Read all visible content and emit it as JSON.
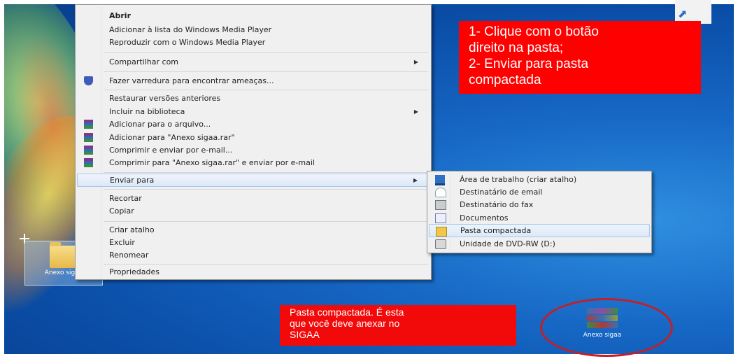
{
  "context_menu": {
    "items": [
      {
        "label": "Abrir",
        "icon": "",
        "submenu": false,
        "bold": true
      },
      {
        "label": "Adicionar à lista do Windows Media Player",
        "icon": "",
        "submenu": false
      },
      {
        "label": "Reproduzir com o Windows Media Player",
        "icon": "",
        "submenu": false
      },
      {
        "label": "Compartilhar com",
        "icon": "",
        "submenu": true
      },
      {
        "label": "Fazer varredura para encontrar ameaças...",
        "icon": "shield-icon",
        "submenu": false
      },
      {
        "label": "Restaurar versões anteriores",
        "icon": "",
        "submenu": false
      },
      {
        "label": "Incluir na biblioteca",
        "icon": "",
        "submenu": true
      },
      {
        "label": "Adicionar para o arquivo...",
        "icon": "winrar-icon",
        "submenu": false
      },
      {
        "label": "Adicionar para \"Anexo sigaa.rar\"",
        "icon": "winrar-icon",
        "submenu": false
      },
      {
        "label": "Comprimir e enviar por e-mail...",
        "icon": "winrar-icon",
        "submenu": false
      },
      {
        "label": "Comprimir para \"Anexo sigaa.rar\" e enviar por e-mail",
        "icon": "winrar-icon",
        "submenu": false
      },
      {
        "label": "Enviar para",
        "icon": "",
        "submenu": true,
        "highlighted": true
      },
      {
        "label": "Recortar",
        "icon": "",
        "submenu": false
      },
      {
        "label": "Copiar",
        "icon": "",
        "submenu": false
      },
      {
        "label": "Criar atalho",
        "icon": "",
        "submenu": false
      },
      {
        "label": "Excluir",
        "icon": "",
        "submenu": false
      },
      {
        "label": "Renomear",
        "icon": "",
        "submenu": false
      },
      {
        "label": "Propriedades",
        "icon": "",
        "submenu": false
      }
    ]
  },
  "send_to_submenu": {
    "items": [
      {
        "label": "Área de trabalho (criar atalho)",
        "icon": "desktop-icon"
      },
      {
        "label": "Destinatário de email",
        "icon": "mail-icon"
      },
      {
        "label": "Destinatário do fax",
        "icon": "fax-icon"
      },
      {
        "label": "Documentos",
        "icon": "documents-icon"
      },
      {
        "label": "Pasta compactada",
        "icon": "zip-folder-icon",
        "highlighted": true
      },
      {
        "label": "Unidade de DVD-RW (D:)",
        "icon": "dvd-drive-icon"
      }
    ]
  },
  "instruction_top": {
    "lines": [
      "1- Clique com o botão",
      "direito na pasta;",
      "2- Enviar para pasta",
      "compactada"
    ]
  },
  "instruction_bottom": {
    "lines": [
      "Pasta compactada. É esta",
      "que você deve anexar no",
      "SIGAA"
    ]
  },
  "desktop": {
    "folder_label": "Anexo sigaa",
    "rar_label": "Anexo sigaa"
  },
  "colors": {
    "note_bg": "#ff0000",
    "highlight_circle": "#c0202a",
    "menu_bg": "#f0f0f0",
    "desktop_blue": "#0a4da6"
  }
}
